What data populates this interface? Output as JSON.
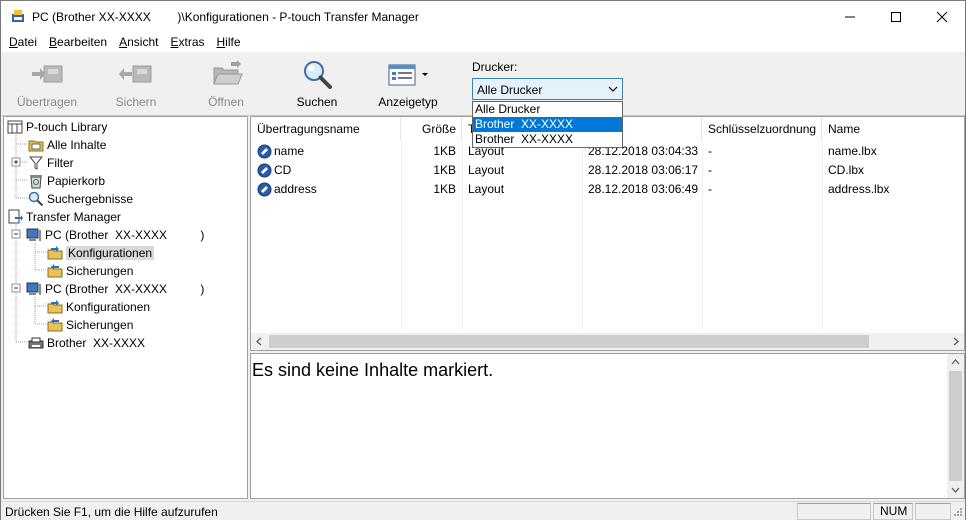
{
  "window": {
    "title": "PC (Brother XX-XXXX        )\\Konfigurationen - P-touch Transfer Manager"
  },
  "menu": [
    {
      "key": "D",
      "rest": "atei"
    },
    {
      "key": "B",
      "rest": "earbeiten"
    },
    {
      "key": "A",
      "rest": "nsicht"
    },
    {
      "key": "E",
      "rest": "xtras"
    },
    {
      "key": "H",
      "rest": "ilfe"
    }
  ],
  "toolbar": {
    "transfer_label": "Übertragen",
    "save_label": "Sichern",
    "open_label": "Öffnen",
    "search_label": "Suchen",
    "view_label": "Anzeigetyp",
    "printer_label": "Drucker:",
    "printer_value": "Alle Drucker",
    "printer_options": [
      "Alle Drucker",
      "Brother  XX-XXXX",
      "Brother  XX-XXXX"
    ]
  },
  "tree": {
    "library": "P-touch Library",
    "all_contents": "Alle Inhalte",
    "filter": "Filter",
    "trash": "Papierkorb",
    "search_results": "Suchergebnisse",
    "transfer_manager": "Transfer Manager",
    "pc1": "PC (Brother  XX-XXXX          )",
    "pc1_configs": "Konfigurationen",
    "pc1_backups": "Sicherungen",
    "pc2": "PC (Brother  XX-XXXX          )",
    "pc2_configs": "Konfigurationen",
    "pc2_backups": "Sicherungen",
    "printer": "Brother  XX-XXXX"
  },
  "list": {
    "columns": [
      "Übertragungsname",
      "Größe",
      "T",
      "",
      "Schlüsselzuordnung",
      "Name"
    ],
    "rows": [
      {
        "name": "name",
        "size": "1KB",
        "type": "Layout",
        "date": "28.12.2018 03:04:33",
        "key": "-",
        "file": "name.lbx"
      },
      {
        "name": "CD",
        "size": "1KB",
        "type": "Layout",
        "date": "28.12.2018 03:06:17",
        "key": "-",
        "file": "CD.lbx"
      },
      {
        "name": "address",
        "size": "1KB",
        "type": "Layout",
        "date": "28.12.2018 03:06:49",
        "key": "-",
        "file": "address.lbx"
      }
    ]
  },
  "detail": {
    "message": "Es sind keine Inhalte markiert."
  },
  "status": {
    "help": "Drücken Sie F1, um die Hilfe aufzurufen",
    "num": "NUM"
  }
}
